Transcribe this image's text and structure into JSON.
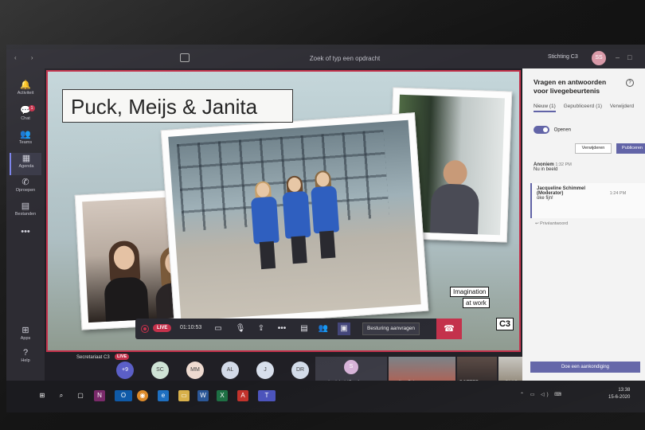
{
  "titlebar": {
    "search_placeholder": "Zoek of typ een opdracht",
    "org_name": "Stichting C3",
    "avatar_initials": "SS"
  },
  "rail": [
    {
      "label": "Activiteit",
      "icon": "bell-icon",
      "glyph": "🔔"
    },
    {
      "label": "Chat",
      "icon": "chat-icon",
      "glyph": "💬",
      "badge": "1"
    },
    {
      "label": "Teams",
      "icon": "teams-icon",
      "glyph": "👥"
    },
    {
      "label": "Agenda",
      "icon": "calendar-icon",
      "glyph": "▦",
      "active": true
    },
    {
      "label": "Oproepen",
      "icon": "phone-icon",
      "glyph": "✆"
    },
    {
      "label": "Bestanden",
      "icon": "files-icon",
      "glyph": "▤"
    },
    {
      "label": "",
      "icon": "more-icon",
      "glyph": "•••"
    }
  ],
  "rail_bottom": [
    {
      "label": "Apps",
      "icon": "apps-icon",
      "glyph": "⊞"
    },
    {
      "label": "Help",
      "icon": "help-icon",
      "glyph": "?"
    }
  ],
  "slide": {
    "title": "Puck, Meijs & Janita",
    "logo_line1": "Imagination",
    "logo_line2": "at work",
    "logo_mark": "C3"
  },
  "controls": {
    "live_badge": "LIVE",
    "timer": "01:10:53",
    "request_control": "Besturing aanvragen"
  },
  "presenter": {
    "name": "Secretariaat C3",
    "live": "LIVE"
  },
  "participants": {
    "bubbles": [
      {
        "label": "+9",
        "color": "#5b5fc7",
        "text_color": "#ffffff"
      },
      {
        "label": "SC",
        "color": "#cfe3d6"
      },
      {
        "label": "MM",
        "color": "#eedad0"
      },
      {
        "label": "AL",
        "color": "#d3dae8"
      },
      {
        "label": "J",
        "color": "#d8dfec"
      },
      {
        "label": "DR",
        "color": "#d3dce9"
      }
    ],
    "tiles": [
      {
        "initial": "S",
        "caption": "samdewinkel (Gast)"
      },
      {
        "caption": "queline Sch...",
        "live": "LIVE"
      },
      {
        "caption": "POTTER..."
      },
      {
        "caption": "...OLAS"
      }
    ]
  },
  "qa": {
    "title": "Vragen en antwoorden voor livegebeurtenis",
    "tabs": [
      "Nieuw (1)",
      "Gepubliceerd (1)",
      "Verwijderd"
    ],
    "toggle_label": "Openen",
    "delete_button": "Verwijderen",
    "publish_button": "Publiceren",
    "question_author": "Anoniem",
    "question_time": "1:32 PM",
    "question_text": "Nu in beeld",
    "reply_author": "Jacqueline Schimmel (Moderator)",
    "reply_time": "1:24 PM",
    "reply_text": "oke fijn!",
    "reply_privately": "Privéantwoord",
    "announce_button": "Doe een aankondiging"
  },
  "taskbar": {
    "time": "13:38",
    "date": "15-6-2020"
  }
}
